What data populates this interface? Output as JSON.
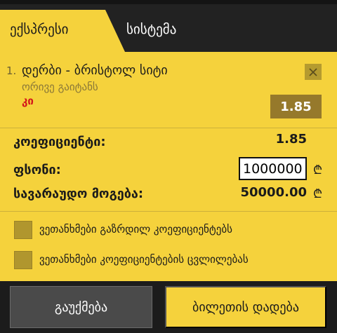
{
  "tabs": {
    "express_label": "ექსპრესი",
    "system_label": "სისტემა"
  },
  "bet": {
    "number": "1.",
    "match": "დერბი - ბრისტოლ სიტი",
    "market": "ორივე გაიტანს",
    "pick": "კი",
    "odd": "1.85",
    "remove_icon": "close-icon"
  },
  "summary": {
    "coefficient_label": "კოეფიციენტი:",
    "coefficient_value": "1.85",
    "stake_label": "ფსონი:",
    "stake_value": "1000000",
    "potential_win_label": "სავარაუდო მოგება:",
    "potential_win_value": "50000.00",
    "currency_symbol": "₾"
  },
  "options": [
    {
      "label": "ვეთანხმები გაზრდილ კოეფიციენტებს",
      "checked": false
    },
    {
      "label": "ვეთანხმები კოეფიციენტების ცვლილებას",
      "checked": false
    }
  ],
  "footer": {
    "clear_label": "გაუქმება",
    "place_label": "ბილეთის დადება"
  },
  "colors": {
    "accent": "#f5d23c",
    "odd_box": "#96792b",
    "pick": "#d4141a",
    "dark": "#1c1c1c"
  }
}
